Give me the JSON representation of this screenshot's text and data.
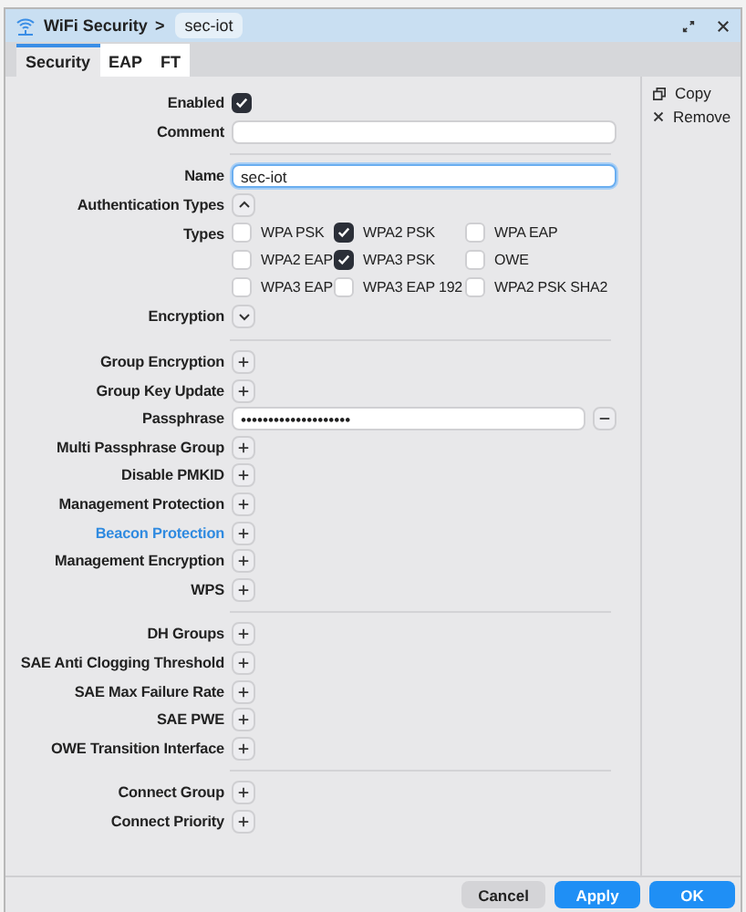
{
  "window": {
    "title": "WiFi Security",
    "separator": ">",
    "record": "sec-iot"
  },
  "tabs": [
    {
      "label": "Security",
      "selected": true
    },
    {
      "label": "EAP",
      "selected": false
    },
    {
      "label": "FT",
      "selected": false
    }
  ],
  "sections": [
    {
      "rows": [
        {
          "kind": "checkbox",
          "label": "Enabled",
          "checked": true,
          "highlighted": false
        },
        {
          "kind": "text",
          "label": "Comment",
          "value": "",
          "highlighted": false
        }
      ]
    },
    {
      "rows": [
        {
          "kind": "text",
          "label": "Name",
          "value": "sec-iot",
          "focused": true,
          "highlighted": false
        },
        {
          "kind": "toggle",
          "label": "Authentication Types",
          "expanded": true,
          "highlighted": false
        },
        {
          "kind": "types",
          "label": "Types",
          "highlighted": false,
          "options": [
            {
              "label": "WPA PSK",
              "checked": false
            },
            {
              "label": "WPA2 PSK",
              "checked": true
            },
            {
              "label": "WPA EAP",
              "checked": false
            },
            {
              "label": "WPA2 EAP",
              "checked": false
            },
            {
              "label": "WPA3 PSK",
              "checked": true
            },
            {
              "label": "OWE",
              "checked": false
            },
            {
              "label": "WPA3 EAP",
              "checked": false
            },
            {
              "label": "WPA3 EAP 192",
              "checked": false
            },
            {
              "label": "WPA2 PSK SHA2",
              "checked": false
            }
          ]
        },
        {
          "kind": "toggle",
          "label": "Encryption",
          "expanded": false,
          "highlighted": false
        }
      ]
    },
    {
      "rows": [
        {
          "kind": "plus",
          "label": "Group Encryption",
          "highlighted": false
        },
        {
          "kind": "plus",
          "label": "Group Key Update",
          "highlighted": false
        },
        {
          "kind": "password",
          "label": "Passphrase",
          "value": "••••••••••••••••••••",
          "highlighted": false
        },
        {
          "kind": "plus",
          "label": "Multi Passphrase Group",
          "highlighted": false
        },
        {
          "kind": "plus",
          "label": "Disable PMKID",
          "highlighted": false
        },
        {
          "kind": "plus",
          "label": "Management Protection",
          "highlighted": false
        },
        {
          "kind": "plus",
          "label": "Beacon Protection",
          "highlighted": true
        },
        {
          "kind": "plus",
          "label": "Management Encryption",
          "highlighted": false
        },
        {
          "kind": "plus",
          "label": "WPS",
          "highlighted": false
        }
      ]
    },
    {
      "rows": [
        {
          "kind": "plus",
          "label": "DH Groups",
          "highlighted": false
        },
        {
          "kind": "plus",
          "label": "SAE Anti Clogging Threshold",
          "highlighted": false
        },
        {
          "kind": "plus",
          "label": "SAE Max Failure Rate",
          "highlighted": false
        },
        {
          "kind": "plus",
          "label": "SAE PWE",
          "highlighted": false
        },
        {
          "kind": "plus",
          "label": "OWE Transition Interface",
          "highlighted": false
        }
      ]
    },
    {
      "rows": [
        {
          "kind": "plus",
          "label": "Connect Group",
          "highlighted": false
        },
        {
          "kind": "plus",
          "label": "Connect Priority",
          "highlighted": false
        }
      ]
    }
  ],
  "side_actions": [
    {
      "kind": "copy",
      "label": "Copy"
    },
    {
      "kind": "remove",
      "label": "Remove"
    }
  ],
  "buttons": [
    {
      "label": "Cancel",
      "kind": "secondary"
    },
    {
      "label": "Apply",
      "kind": "primary"
    },
    {
      "label": "OK",
      "kind": "primary"
    }
  ]
}
